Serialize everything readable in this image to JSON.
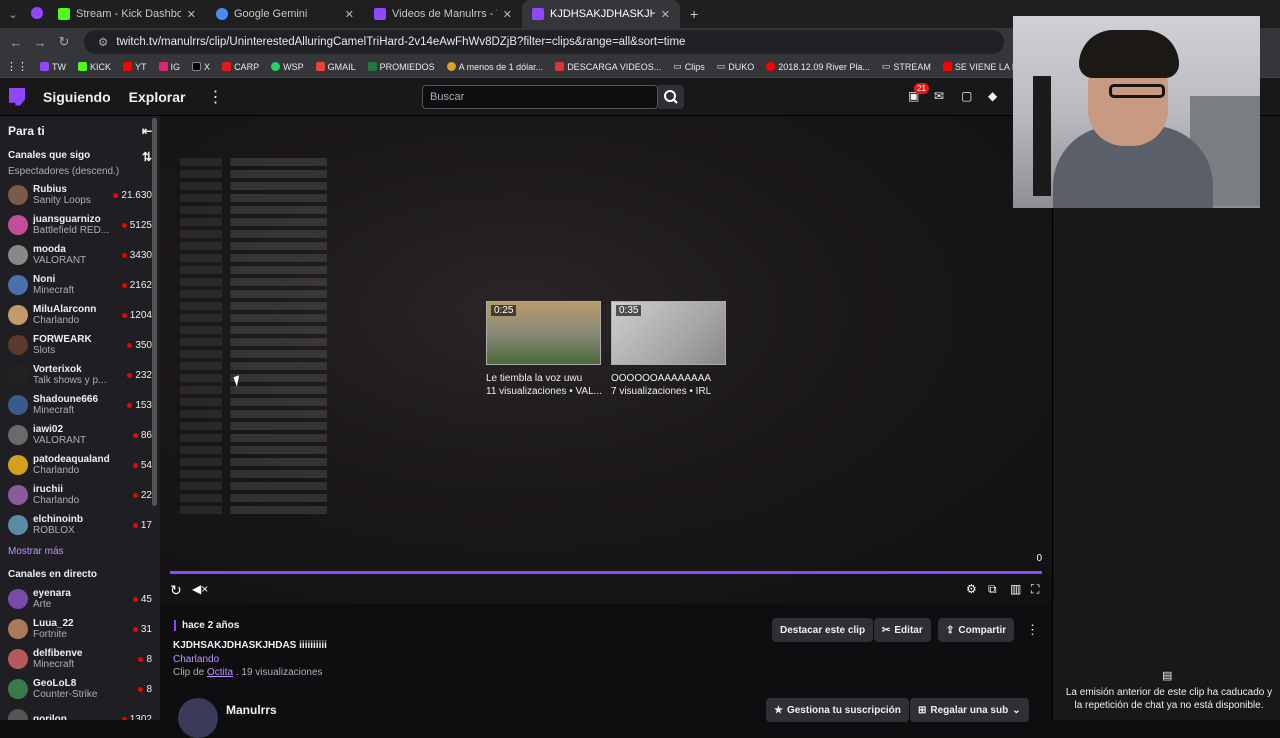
{
  "browser": {
    "tabs": [
      {
        "title": "Stream - Kick Dashboard",
        "icon": "kick-icon",
        "color": "#53fc18"
      },
      {
        "title": "Google Gemini",
        "icon": "gemini-icon",
        "color": "#4a8cff"
      },
      {
        "title": "Videos de Manulrrs - Twitch",
        "icon": "twitch-icon",
        "color": "#9147ff"
      },
      {
        "title": "KJDHSAKJDHASKJHDAS iiiiiiiiii",
        "icon": "twitch-icon",
        "color": "#9147ff"
      }
    ],
    "url": "twitch.tv/manulrrs/clip/UninterestedAlluringCamelTriHard-2v14eAwFhWv8DZjB?filter=clips&range=all&sort=time",
    "bookmarks": [
      "TW",
      "KICK",
      "YT",
      "IG",
      "X",
      "CARP",
      "WSP",
      "GMAIL",
      "PROMIEDOS",
      "A menos de 1 dólar...",
      "DESCARGA VIDEOS...",
      "Clips",
      "DUKO",
      "2018.12.09 River Pla...",
      "STREAM",
      "SE VIENE LA BAND..."
    ]
  },
  "nav": {
    "following": "Siguiendo",
    "explore": "Explorar",
    "search_placeholder": "Buscar",
    "notif_count": "21"
  },
  "sidebar": {
    "title": "Para ti",
    "followed_heading": "Canales que sigo",
    "sort_label": "Espectadores (descend.)",
    "followed": [
      {
        "name": "Rubius",
        "game": "Sanity Loops",
        "viewers": "21.630",
        "color": "#7a5a48"
      },
      {
        "name": "juansguarnizo",
        "game": "Battlefield RED...",
        "viewers": "5125",
        "color": "#c44d9a"
      },
      {
        "name": "mooda",
        "game": "VALORANT",
        "viewers": "3430",
        "color": "#888888"
      },
      {
        "name": "Noni",
        "game": "Minecraft",
        "viewers": "2162",
        "color": "#4b6fa8"
      },
      {
        "name": "MiluAlarconn",
        "game": "Charlando",
        "viewers": "1204",
        "color": "#c49a6c"
      },
      {
        "name": "FORWEARK",
        "game": "Slots",
        "viewers": "350",
        "color": "#5a3a2a"
      },
      {
        "name": "Vorterixok",
        "game": "Talk shows y p...",
        "viewers": "232",
        "color": "#222222"
      },
      {
        "name": "Shadoune666",
        "game": "Minecraft",
        "viewers": "153",
        "color": "#3a5a8a"
      },
      {
        "name": "iawi02",
        "game": "VALORANT",
        "viewers": "86",
        "color": "#6a6a6a"
      },
      {
        "name": "patodeaqualand",
        "game": "Charlando",
        "viewers": "54",
        "color": "#d4a020"
      },
      {
        "name": "iruchii",
        "game": "Charlando",
        "viewers": "22",
        "color": "#8a5a9a"
      },
      {
        "name": "elchinoinb",
        "game": "ROBLOX",
        "viewers": "17",
        "color": "#5a8aa8"
      }
    ],
    "show_more": "Mostrar más",
    "live_heading": "Canales en directo",
    "live": [
      {
        "name": "eyenara",
        "game": "Arte",
        "viewers": "45",
        "color": "#7a4aa8"
      },
      {
        "name": "Luua_22",
        "game": "Fortnite",
        "viewers": "31",
        "color": "#a87a5a"
      },
      {
        "name": "delfibenve",
        "game": "Minecraft",
        "viewers": "8",
        "color": "#b45a5a"
      },
      {
        "name": "GeoLoL8",
        "game": "Counter-Strike",
        "viewers": "8",
        "color": "#3a7a4a"
      },
      {
        "name": "gorilon",
        "game": "",
        "viewers": "1302",
        "color": "#555555"
      }
    ]
  },
  "player": {
    "recommendations": [
      {
        "duration": "0:25",
        "title": "Le tiembla la voz uwu",
        "meta": "11 visualizaciones • VAL...",
        "color": "#6a6a50"
      },
      {
        "duration": "0:35",
        "title": "OOOOOOAAAAAAAA",
        "meta": "7 visualizaciones • IRL",
        "color": "#b8b8b8"
      }
    ],
    "progress_count": "0",
    "progress": 1.0
  },
  "clip": {
    "ago": "hace 2 años",
    "title": "KJDHSAKJDHASKJHDAS iiiiiiiiii",
    "category": "Charlando",
    "clip_by_prefix": "Clip de",
    "clipper": "Octita",
    "views": ". 19 visualizaciones",
    "highlight_btn": "Destacar este clip",
    "edit_btn": "Editar",
    "share_btn": "Compartir"
  },
  "channel": {
    "name": "Manulrrs",
    "manage_sub": "Gestiona tu suscripción",
    "gift_sub": "Regalar una sub"
  },
  "chat": {
    "unavailable": "La emisión anterior de este clip ha caducado y la repetición de chat ya no está disponible."
  }
}
